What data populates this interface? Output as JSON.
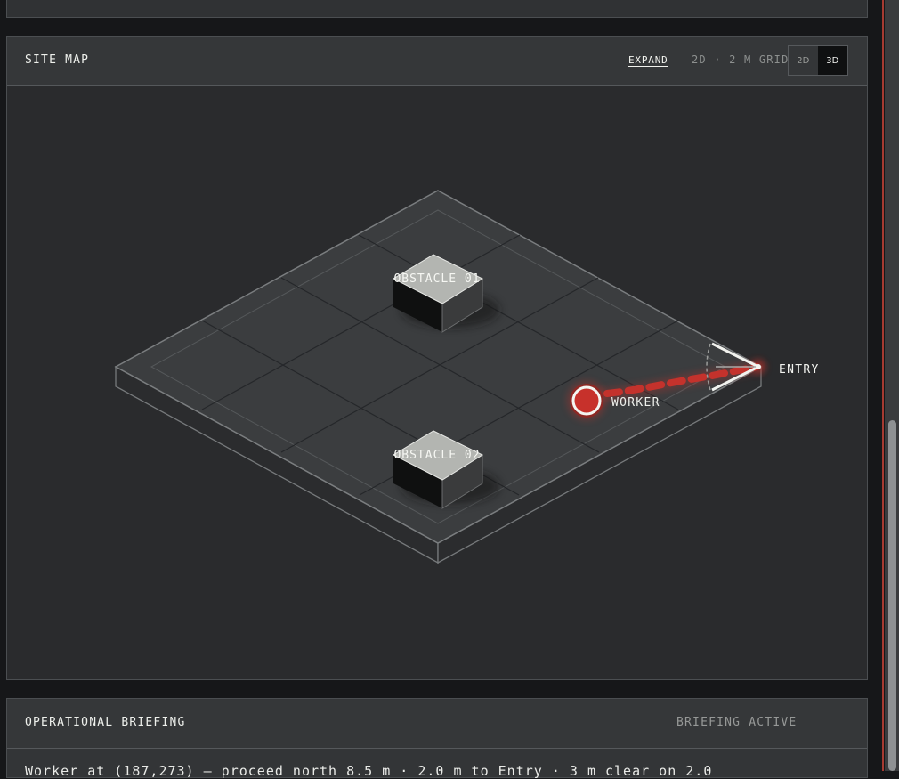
{
  "site_map": {
    "title": "SITE MAP",
    "expand_label": "EXPAND",
    "grid_info": "2D · 2 M GRID",
    "toggle": {
      "options": [
        "2D",
        "3D"
      ],
      "selected": "3D"
    },
    "obstacles": [
      "OBSTACLE 01",
      "OBSTACLE 02"
    ],
    "worker_label": "WORKER",
    "entry_label": "ENTRY"
  },
  "briefing": {
    "title": "OPERATIONAL BRIEFING",
    "status": "BRIEFING ACTIVE",
    "line": "Worker at (187,273) — proceed north 8.5 m · 2.0 m to Entry · 3 m clear on 2.0"
  },
  "colors": {
    "accent_red": "#c4322c",
    "background": "#2a2b2d"
  }
}
